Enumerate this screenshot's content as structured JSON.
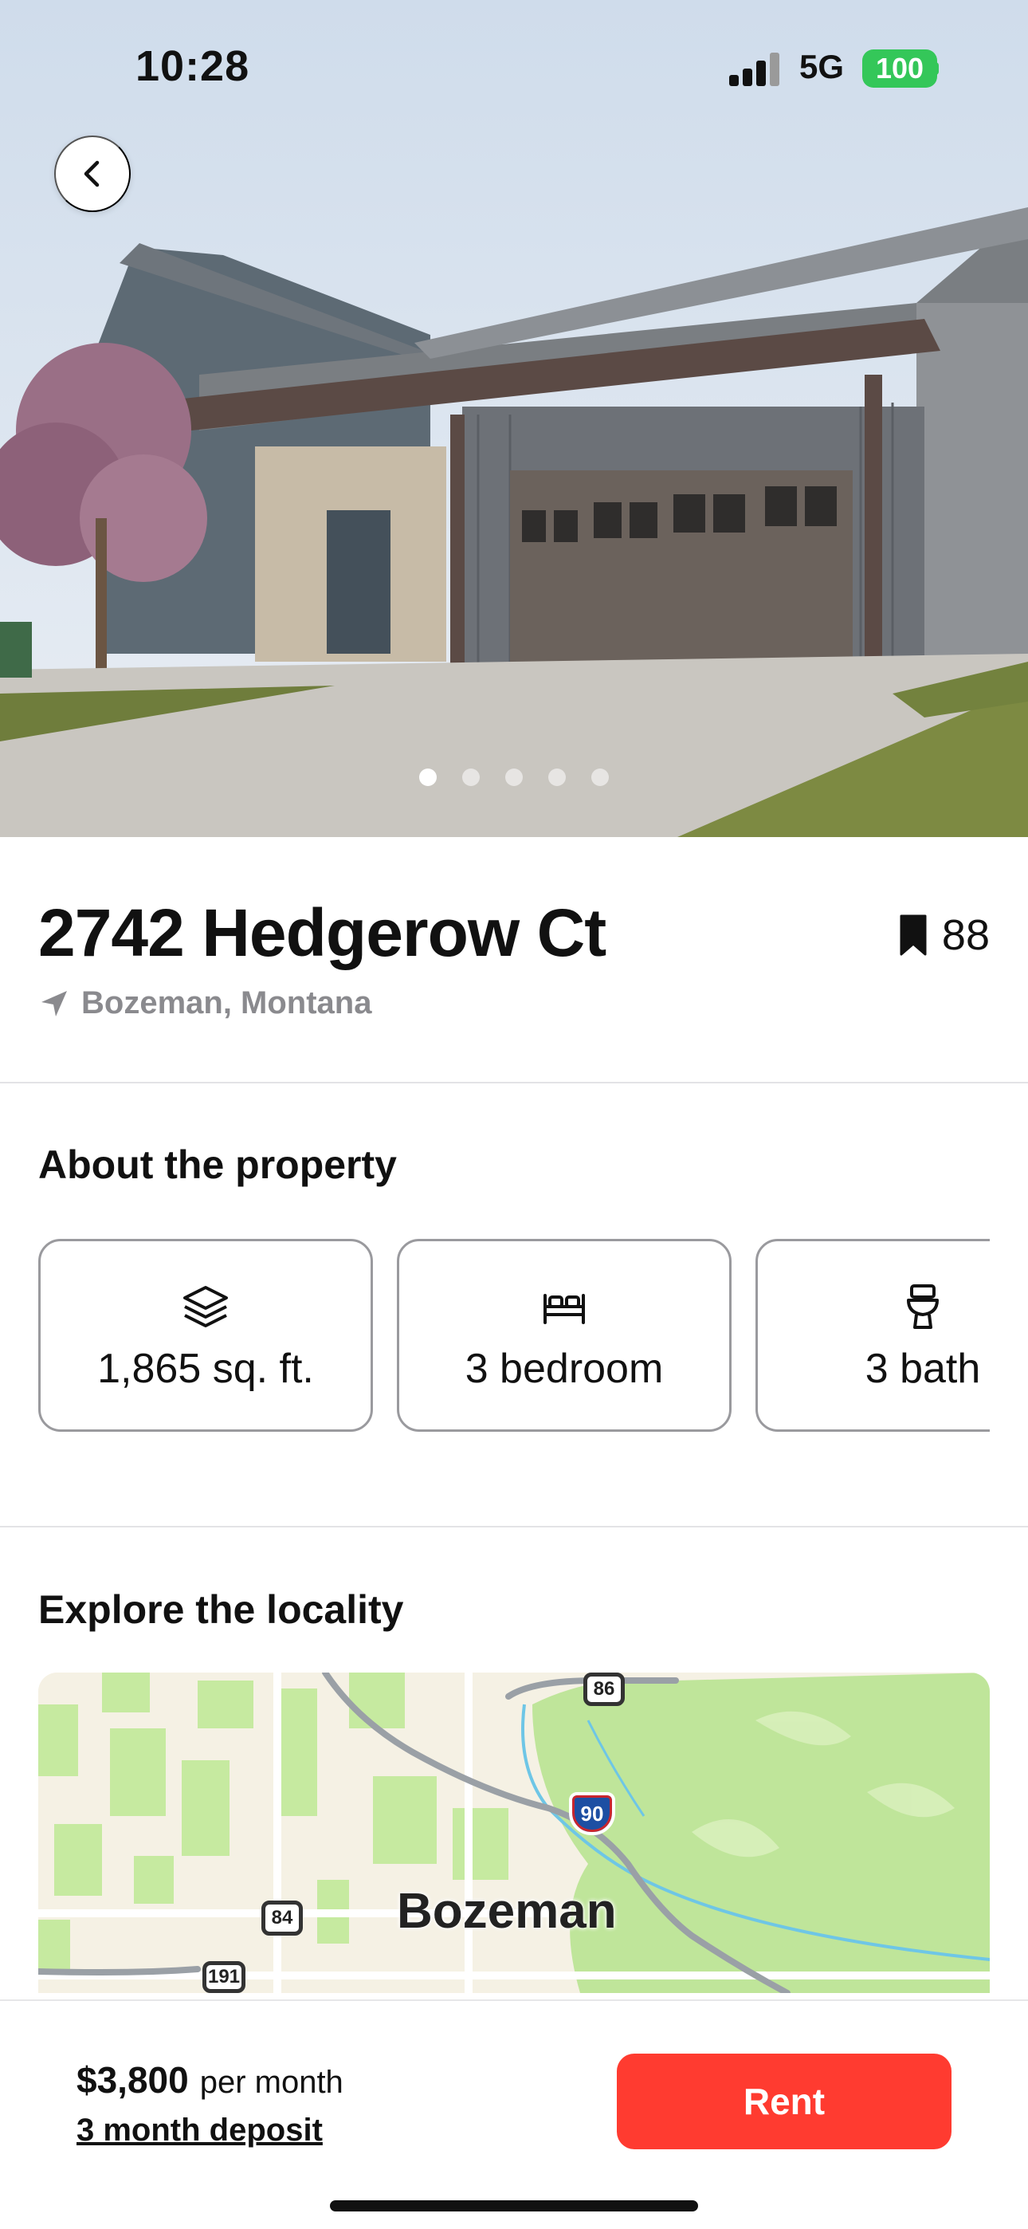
{
  "status_bar": {
    "time": "10:28",
    "network": "5G",
    "battery": "100"
  },
  "hero": {
    "photo_count": 5,
    "active_photo": 1
  },
  "property": {
    "address": "2742 Hedgerow Ct",
    "location": "Bozeman, Montana",
    "saves": "88"
  },
  "about": {
    "heading": "About the property",
    "features": [
      {
        "icon": "layers-icon",
        "label": "1,865 sq. ft."
      },
      {
        "icon": "bed-icon",
        "label": "3 bedroom"
      },
      {
        "icon": "toilet-icon",
        "label": "3 bath"
      }
    ]
  },
  "locality": {
    "heading": "Explore the locality",
    "map": {
      "city_label": "Bozeman",
      "shields": {
        "us86": "86",
        "us84": "84",
        "us191": "191",
        "i90": "90"
      }
    }
  },
  "footer": {
    "price": "$3,800",
    "price_unit": "per month",
    "deposit": "3 month deposit",
    "rent_label": "Rent"
  },
  "colors": {
    "accent": "#ff3b30",
    "battery": "#34c759",
    "muted_text": "#8a8a8e"
  }
}
